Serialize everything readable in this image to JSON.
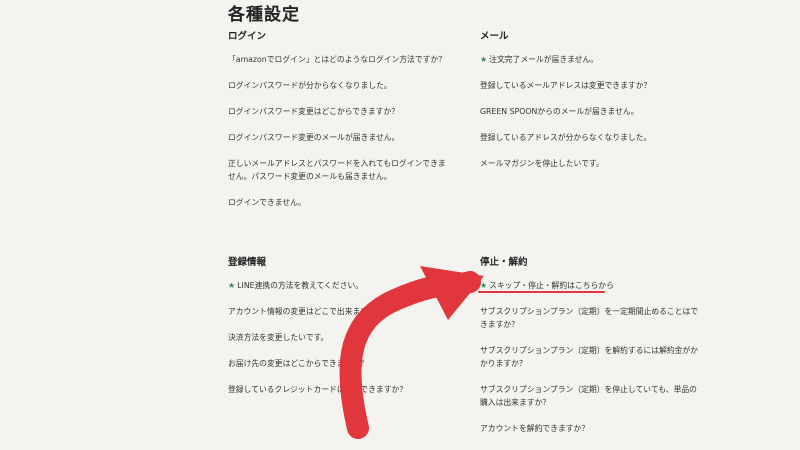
{
  "page": {
    "title": "各種設定"
  },
  "sections": {
    "login": {
      "title": "ログイン",
      "items": [
        "「amazonでログイン」とはどのようなログイン方法ですか？",
        "ログインパスワードが分からなくなりました。",
        "ログインパスワード変更はどこからできますか？",
        "ログインパスワード変更のメールが届きません。",
        "正しいメールアドレスとパスワードを入れてもログインできません。パスワード変更のメールも届きません。",
        "ログインできません。"
      ]
    },
    "mail": {
      "title": "メール",
      "items": [
        "注文完了メールが届きません。",
        "登録しているメールアドレスは変更できますか？",
        "GREEN SPOONからのメールが届きません。",
        "登録しているアドレスが分からなくなりました。",
        "メールマガジンを停止したいです。"
      ]
    },
    "registration": {
      "title": "登録情報",
      "items": [
        "LINE連携の方法を教えてください。",
        "アカウント情報の変更はどこで出来ますか？",
        "決済方法を変更したいです。",
        "お届け先の変更はどこからできますか？",
        "登録しているクレジットカードは変更できますか？"
      ]
    },
    "cancel": {
      "title": "停止・解約",
      "items": [
        "スキップ・停止・解約はこちらから",
        "サブスクリプションプラン（定期）を一定期間止めることはできますか？",
        "サブスクリプションプラン（定期）を解約するには解約金がかかりますか？",
        "サブスクリプションプラン（定期）を停止していても、単品の購入は出来ますか？",
        "アカウントを解約できますか？"
      ]
    }
  },
  "icons": {
    "featured": "star-icon"
  },
  "colors": {
    "background": "#f4f3ef",
    "accent_star": "#2e8b57",
    "annotation": "#e0363c"
  }
}
